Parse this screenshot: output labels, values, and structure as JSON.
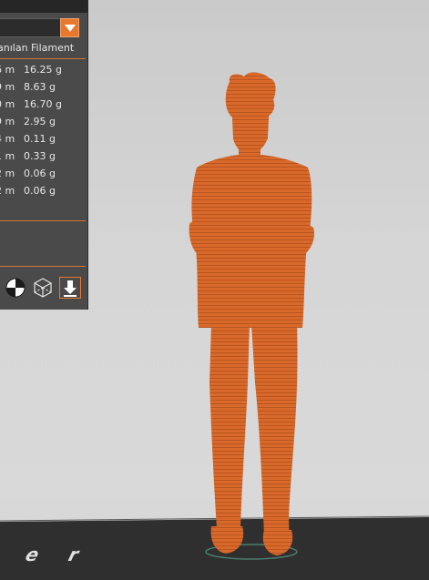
{
  "panel": {
    "column_header": "anılan Filament",
    "rows": [
      {
        "length": "6 m",
        "weight": "16.25 g"
      },
      {
        "length": "9 m",
        "weight": "8.63 g"
      },
      {
        "length": "0 m",
        "weight": "16.70 g"
      },
      {
        "length": "9 m",
        "weight": "2.95 g"
      },
      {
        "length": "4 m",
        "weight": "0.11 g"
      },
      {
        "length": "1 m",
        "weight": "0.33 g"
      },
      {
        "length": "2 m",
        "weight": "0.06 g"
      },
      {
        "length": "2 m",
        "weight": "0.06 g"
      }
    ],
    "view_icons": [
      "section-view-icon",
      "wireframe-cube-icon",
      "export-down-icon"
    ]
  },
  "colors": {
    "accent": "#e8782d",
    "panel_bg": "#4a4a4a",
    "model": "#d9692a",
    "bed": "#2f2f2f",
    "background": "#d3d3d3"
  }
}
